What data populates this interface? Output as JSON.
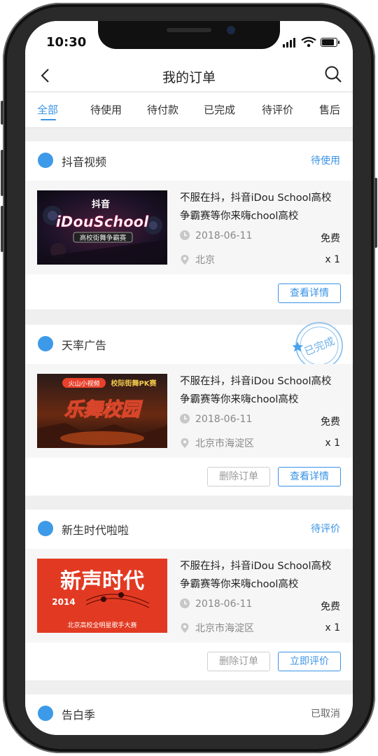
{
  "status_bar": {
    "time": "10:30"
  },
  "header": {
    "title": "我的订单"
  },
  "tabs": [
    "全部",
    "待使用",
    "待付款",
    "已完成",
    "待评价",
    "售后"
  ],
  "orders": [
    {
      "shop": "抖音视频",
      "status": "待使用",
      "title": "不服在抖，抖音iDou School高校争霸赛等你来嗨chool高校",
      "date": "2018-06-11",
      "price": "免费",
      "location": "北京",
      "qty": "x 1",
      "thumb_text": [
        "抖音",
        "iDouSchool",
        "高校街舞争霸赛"
      ],
      "buttons": [
        "查看详情"
      ]
    },
    {
      "shop": "天率广告",
      "status_stamp": "已完成",
      "title": "不服在抖，抖音iDou School高校争霸赛等你来嗨chool高校",
      "date": "2018-06-11",
      "price": "免费",
      "location": "北京市海淀区",
      "qty": "x 1",
      "thumb_text": [
        "火山小视频",
        "校际街舞PK赛",
        "乐舞校园"
      ],
      "buttons": [
        "删除订单",
        "查看详情"
      ]
    },
    {
      "shop": "新生时代啦啦",
      "status": "待评价",
      "title": "不服在抖，抖音iDou School高校争霸赛等你来嗨chool高校",
      "date": "2018-06-11",
      "price": "免费",
      "location": "北京市海淀区",
      "qty": "x 1",
      "thumb_text": [
        "新声时代",
        "2014",
        "北京高校全明星歌手大赛"
      ],
      "buttons": [
        "删除订单",
        "立即评价"
      ]
    },
    {
      "shop": "告白季",
      "status": "已取消"
    }
  ],
  "colors": {
    "accent": "#3a93e6",
    "dot": "#3d9ae8",
    "background": "#efefef"
  }
}
